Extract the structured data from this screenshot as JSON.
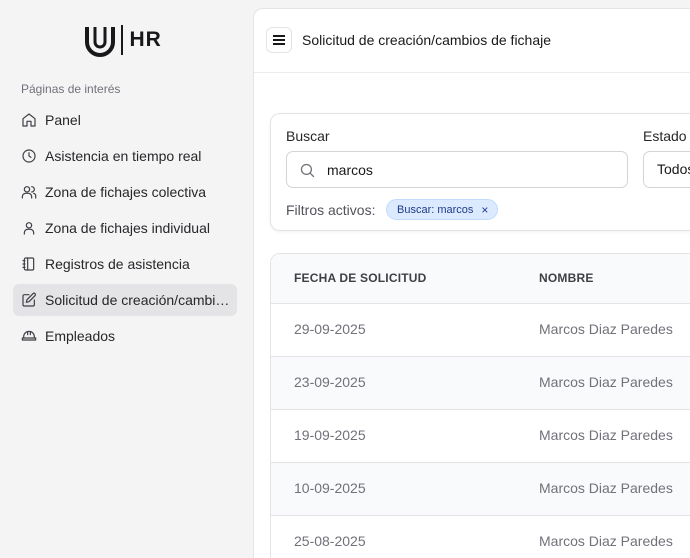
{
  "brand": {
    "logo_text": "HR"
  },
  "sidebar": {
    "section_label": "Páginas de interés",
    "items": [
      {
        "label": "Panel",
        "icon": "home-icon",
        "active": false
      },
      {
        "label": "Asistencia en tiempo real",
        "icon": "clock-icon",
        "active": false
      },
      {
        "label": "Zona de fichajes colectiva",
        "icon": "users-icon",
        "active": false
      },
      {
        "label": "Zona de fichajes individual",
        "icon": "user-icon",
        "active": false
      },
      {
        "label": "Registros de asistencia",
        "icon": "notebook-icon",
        "active": false
      },
      {
        "label": "Solicitud de creación/cambios de fichaje",
        "icon": "edit-icon",
        "active": true
      },
      {
        "label": "Empleados",
        "icon": "hard-hat-icon",
        "active": false
      }
    ]
  },
  "header": {
    "title": "Solicitud de creación/cambios de fichaje"
  },
  "filters": {
    "search_label": "Buscar",
    "search_value": "marcos",
    "estado_label": "Estado",
    "estado_value": "Todos",
    "active_label": "Filtros activos:",
    "chip_label": "Buscar: marcos",
    "chip_remove": "×"
  },
  "table": {
    "columns": [
      "FECHA DE SOLICITUD",
      "NOMBRE"
    ],
    "rows": [
      [
        "29-09-2025",
        "Marcos Diaz Paredes"
      ],
      [
        "23-09-2025",
        "Marcos Diaz Paredes"
      ],
      [
        "19-09-2025",
        "Marcos Diaz Paredes"
      ],
      [
        "10-09-2025",
        "Marcos Diaz Paredes"
      ],
      [
        "25-08-2025",
        "Marcos Diaz Paredes"
      ]
    ]
  },
  "colors": {
    "chip_bg": "#dbeafe",
    "chip_text": "#1e3a8a",
    "active_nav": "#e4e4e7"
  }
}
